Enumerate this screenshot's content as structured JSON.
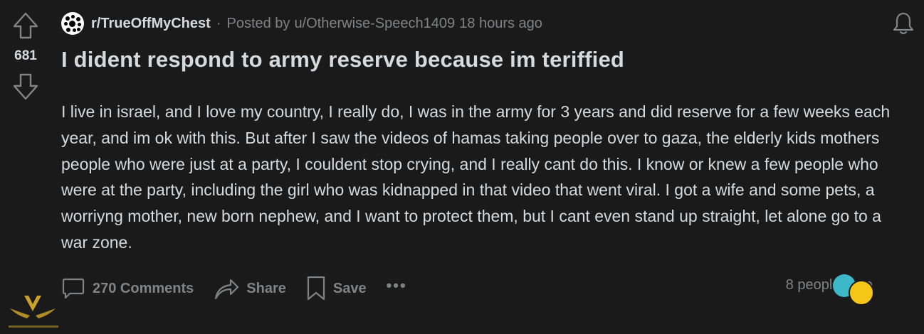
{
  "vote": {
    "score": "681"
  },
  "header": {
    "subreddit": "r/TrueOffMyChest",
    "separator": "·",
    "posted_by": "Posted by",
    "username": "u/Otherwise-Speech1409",
    "time_ago": "18 hours ago"
  },
  "post": {
    "title": "I dident respond to army reserve because im teriffied",
    "body": "I live in israel, and I love my country, I really do, I was in the army for 3 years and did reserve for a few weeks each year, and im ok with this. But after I saw the videos of hamas taking people over to gaza, the elderly kids mothers people who were just at a party, I couldent stop crying, and I really cant do this. I know or knew a few people who were at the party, including the girl who was kidnapped in that video that went viral. I got a wife and some pets, a worriyng mother, new born nephew, and I want to protect them, but I cant even stand up straight, let alone go to a war zone."
  },
  "actions": {
    "comments": "270 Comments",
    "share": "Share",
    "save": "Save",
    "more": "•••"
  },
  "presence": {
    "text": "8 people here"
  },
  "colors": {
    "background": "#1a1a1b",
    "text_primary": "#d7dadc",
    "text_muted": "#818384"
  },
  "icons": {
    "upvote": "upvote-arrow-icon",
    "downvote": "downvote-arrow-icon",
    "bell": "bell-icon",
    "comment": "comment-bubble-icon",
    "share": "share-arrow-icon",
    "save": "bookmark-icon",
    "more": "more-dots-icon"
  }
}
